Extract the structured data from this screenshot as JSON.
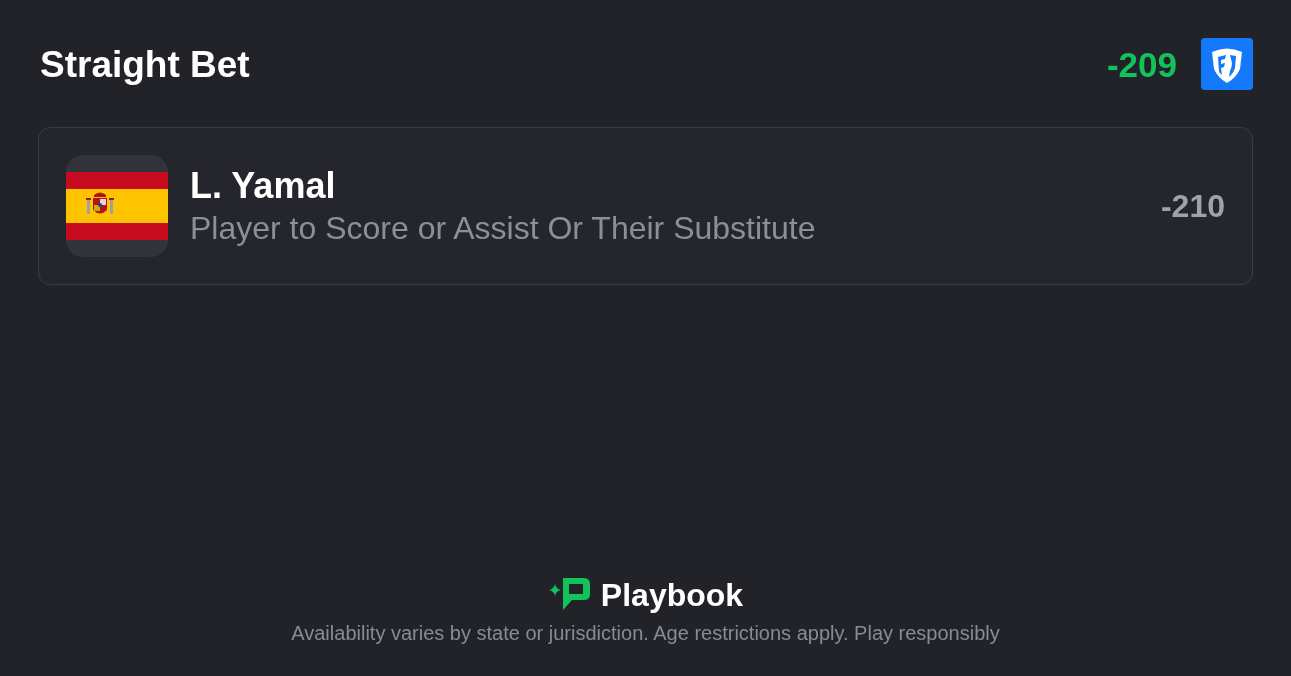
{
  "header": {
    "title": "Straight Bet",
    "odds": "-209"
  },
  "selection": {
    "player": "L. Yamal",
    "market": "Player to Score or Assist Or Their Substitute",
    "odds": "-210"
  },
  "footer": {
    "brand": "Playbook",
    "disclaimer": "Availability varies by state or jurisdiction. Age restrictions apply. Play responsibly"
  }
}
